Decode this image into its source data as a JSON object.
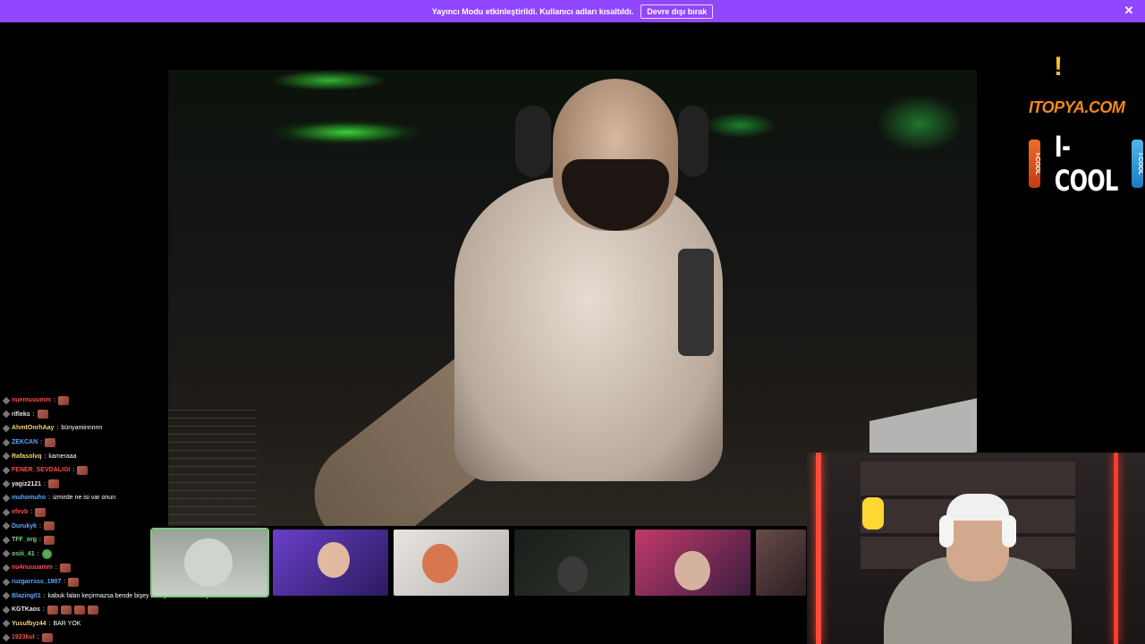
{
  "banner": {
    "message": "Yayıncı Modu etkinleştirildi. Kullanıcı adları kısaltıldı.",
    "button_label": "Devre dışı bırak",
    "close_glyph": "✕",
    "color": "#9147ff"
  },
  "sponsors": {
    "alert_glyph": "!",
    "itopya": "ITOPYA.COM",
    "icool": "I-COOL",
    "can_label": "I-COOL"
  },
  "chat": [
    {
      "user": "nuemuuumm",
      "color": "#ff4b4b",
      "text": "",
      "emotes": 1
    },
    {
      "user": "rifleks",
      "color": "#e6e6e6",
      "text": "",
      "emotes": 1
    },
    {
      "user": "AhmtOnrhAay",
      "color": "#f5d36b",
      "text": "bünyaminnnnn",
      "emotes": 0
    },
    {
      "user": "ZEKCAN",
      "color": "#5aa8ff",
      "text": "",
      "emotes": 1
    },
    {
      "user": "Rafasolvq",
      "color": "#f5d36b",
      "text": "kameraaa",
      "emotes": 0
    },
    {
      "user": "FENER_SEVDALIGI",
      "color": "#ff4b4b",
      "text": "",
      "emotes": 1
    },
    {
      "user": "yagiz2121",
      "color": "#e6e6e6",
      "text": "",
      "emotes": 1
    },
    {
      "user": "muhomuho",
      "color": "#5aa8ff",
      "text": "izmirde ne isi var onun",
      "emotes": 0
    },
    {
      "user": "efevb",
      "color": "#ff4b4b",
      "text": "",
      "emotes": 1
    },
    {
      "user": "Durukyk",
      "color": "#5aa8ff",
      "text": "",
      "emotes": 1
    },
    {
      "user": "TFF_org",
      "color": "#7ad47a",
      "text": "",
      "emotes": 1
    },
    {
      "user": "osiii_41",
      "color": "#7ad47a",
      "text": "",
      "emotes": 1,
      "green": true
    },
    {
      "user": "nu4nuuuamm",
      "color": "#ff4b4b",
      "text": "",
      "emotes": 1
    },
    {
      "user": "ruzgarrsss_1907",
      "color": "#5aa8ff",
      "text": "",
      "emotes": 1
    },
    {
      "user": "Blazing01",
      "color": "#5aa8ff",
      "text": "kabuk falan keçirmazsa bende bişey bilmiyrum hocam osjoisdhsd",
      "emotes": 0
    },
    {
      "user": "KGTKaos",
      "color": "#e6e6e6",
      "text": "",
      "emotes": 4
    },
    {
      "user": "Yusufbyz44",
      "color": "#f5d36b",
      "text": "BAR YOK",
      "emotes": 0
    },
    {
      "user": "1923kul",
      "color": "#ff4b4b",
      "text": "",
      "emotes": 1
    }
  ]
}
